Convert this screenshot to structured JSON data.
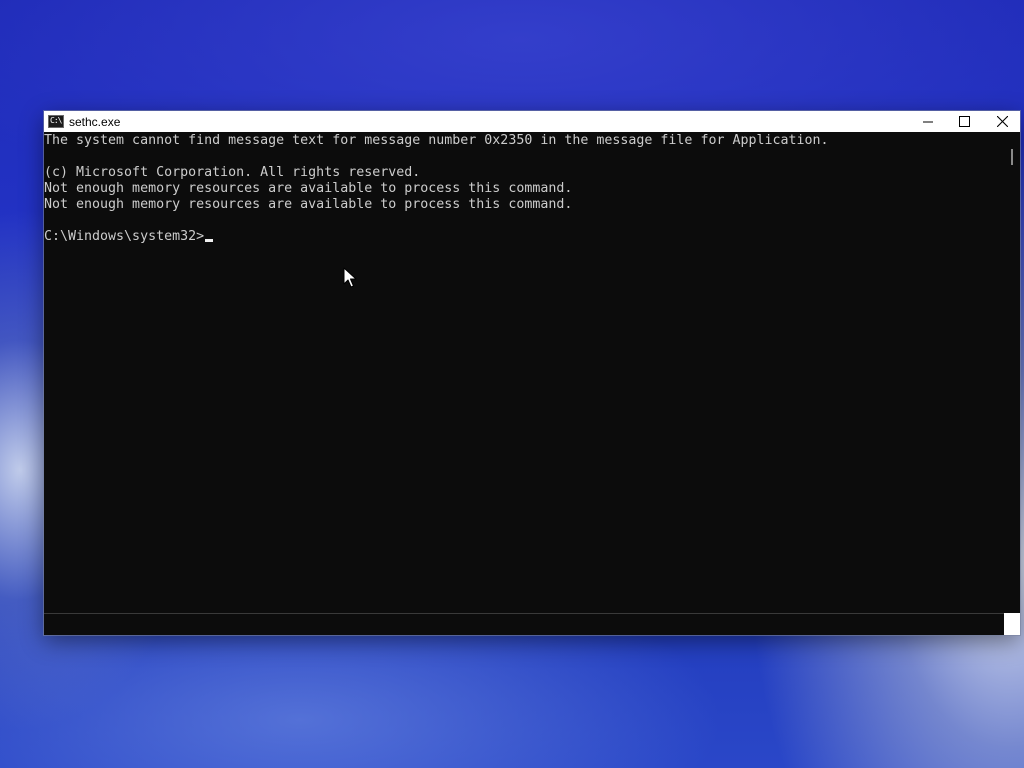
{
  "window": {
    "title": "sethc.exe",
    "icon": "cmd-icon",
    "icon_glyph": "C:\\",
    "controls": {
      "minimize": "minimize-icon",
      "maximize": "maximize-icon",
      "close": "close-icon"
    }
  },
  "console": {
    "lines": [
      "The system cannot find message text for message number 0x2350 in the message file for Application.",
      "",
      "(c) Microsoft Corporation. All rights reserved.",
      "Not enough memory resources are available to process this command.",
      "Not enough memory resources are available to process this command.",
      ""
    ],
    "prompt": "C:\\Windows\\system32>",
    "text_color": "#cccccc",
    "background": "#0c0c0c"
  },
  "colors": {
    "desktop_blue": "#2232c4",
    "titlebar": "#ffffff"
  }
}
